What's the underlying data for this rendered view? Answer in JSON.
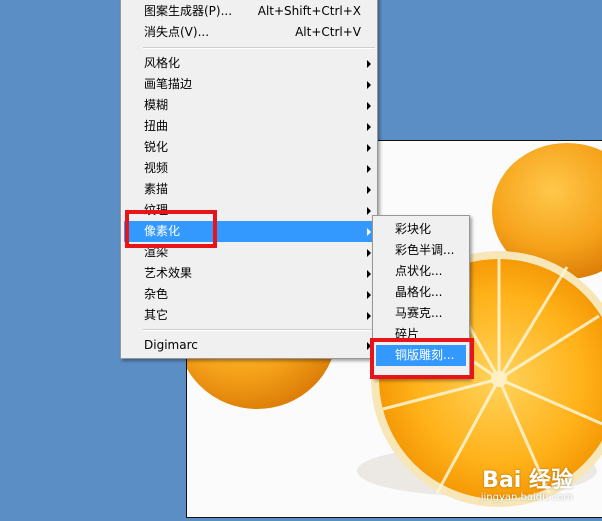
{
  "filter_menu": {
    "items": [
      {
        "label": "图案生成器(P)...",
        "shortcut": "Alt+Shift+Ctrl+X"
      },
      {
        "label": "消失点(V)...",
        "shortcut": "Alt+Ctrl+V"
      },
      {
        "label": "风格化"
      },
      {
        "label": "画笔描边"
      },
      {
        "label": "模糊"
      },
      {
        "label": "扭曲"
      },
      {
        "label": "锐化"
      },
      {
        "label": "视频"
      },
      {
        "label": "素描"
      },
      {
        "label": "纹理"
      },
      {
        "label": "像素化",
        "selected": true
      },
      {
        "label": "渲染"
      },
      {
        "label": "艺术效果"
      },
      {
        "label": "杂色"
      },
      {
        "label": "其它"
      },
      {
        "label": "Digimarc"
      }
    ]
  },
  "pixelate_submenu": {
    "items": [
      {
        "label": "彩块化"
      },
      {
        "label": "彩色半调..."
      },
      {
        "label": "点状化..."
      },
      {
        "label": "晶格化..."
      },
      {
        "label": "马赛克..."
      },
      {
        "label": "碎片"
      },
      {
        "label": "铜版雕刻...",
        "selected": true
      }
    ]
  },
  "watermark": {
    "brand": "Bai 经验",
    "url": "jingyan.baidu.com"
  },
  "colors": {
    "background": "#5b8ec4",
    "highlight": "#3399ff",
    "annotation": "#e8141a",
    "menu_bg": "#f0f0f0"
  },
  "icons": [
    "submenu-arrow-icon",
    "baidu-paw-icon"
  ]
}
